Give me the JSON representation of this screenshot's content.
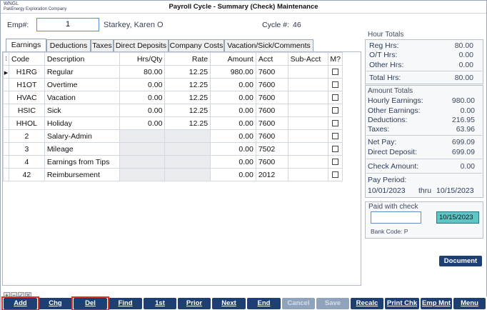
{
  "window": {
    "app_code": "WNGL",
    "company": "PakEnergy Exploration Company",
    "title": "Payroll Cycle - Summary (Check) Maintenance"
  },
  "header": {
    "emp_label": "Emp#:",
    "emp_value": "1",
    "emp_name": "Starkey, Karen O",
    "cycle_label": "Cycle #:",
    "cycle_value": "46"
  },
  "tabs": [
    "Earnings",
    "Deductions",
    "Taxes",
    "Direct Deposits",
    "Company Costs",
    "Vacation/Sick/Comments"
  ],
  "grid": {
    "columns": [
      "Code",
      "Description",
      "Hrs/Qty",
      "Rate",
      "Amount",
      "Acct",
      "Sub-Acct",
      "M?"
    ],
    "rows": [
      {
        "code": "H1RG",
        "desc": "Regular",
        "hrs": "80.00",
        "rate": "12.25",
        "amount": "980.00",
        "acct": "7600",
        "sub": ""
      },
      {
        "code": "H1OT",
        "desc": "Overtime",
        "hrs": "0.00",
        "rate": "12.25",
        "amount": "0.00",
        "acct": "7600",
        "sub": ""
      },
      {
        "code": "HVAC",
        "desc": "Vacation",
        "hrs": "0.00",
        "rate": "12.25",
        "amount": "0.00",
        "acct": "7600",
        "sub": ""
      },
      {
        "code": "HSIC",
        "desc": "Sick",
        "hrs": "0.00",
        "rate": "12.25",
        "amount": "0.00",
        "acct": "7600",
        "sub": ""
      },
      {
        "code": "HHOL",
        "desc": "Holiday",
        "hrs": "0.00",
        "rate": "12.25",
        "amount": "0.00",
        "acct": "7600",
        "sub": ""
      },
      {
        "code": "2",
        "desc": "Salary-Admin",
        "hrs": "",
        "rate": "",
        "amount": "0.00",
        "acct": "7600",
        "sub": ""
      },
      {
        "code": "3",
        "desc": "Mileage",
        "hrs": "",
        "rate": "",
        "amount": "0.00",
        "acct": "7502",
        "sub": ""
      },
      {
        "code": "4",
        "desc": "Earnings from Tips",
        "hrs": "",
        "rate": "",
        "amount": "0.00",
        "acct": "7600",
        "sub": ""
      },
      {
        "code": "42",
        "desc": "Reimbursement",
        "hrs": "",
        "rate": "",
        "amount": "0.00",
        "acct": "2012",
        "sub": ""
      }
    ]
  },
  "hour_totals": {
    "title": "Hour Totals",
    "reg_label": "Reg Hrs:",
    "reg_value": "80.00",
    "ot_label": "O/T Hrs:",
    "ot_value": "0.00",
    "other_label": "Other Hrs:",
    "other_value": "0.00",
    "total_label": "Total Hrs:",
    "total_value": "80.00"
  },
  "amount_totals": {
    "title": "Amount Totals",
    "hourly_label": "Hourly Earnings:",
    "hourly_value": "980.00",
    "other_label": "Other Earnings:",
    "other_value": "0.00",
    "ded_label": "Deductions:",
    "ded_value": "216.95",
    "tax_label": "Taxes:",
    "tax_value": "63.96",
    "net_label": "Net Pay:",
    "net_value": "699.09",
    "dd_label": "Direct Deposit:",
    "dd_value": "699.09",
    "check_label": "Check Amount:",
    "check_value": "0.00",
    "period_label": "Pay Period:",
    "period_from": "10/01/2023",
    "period_thru": "thru",
    "period_to": "10/15/2023"
  },
  "paid_check": {
    "title": "Paid with check",
    "check_no": "",
    "date": "10/15/2023",
    "bank_code": "Bank Code: P"
  },
  "document_button": "Document",
  "toolbar": [
    "Add",
    "Chg",
    "Del",
    "Find",
    "1st",
    "Prior",
    "Next",
    "End",
    "Cancel",
    "Save",
    "Recalc",
    "Print Chk",
    "Emp Mnt",
    "Menu"
  ],
  "grid_controls": [
    "+",
    "−",
    "✓",
    "✕"
  ]
}
